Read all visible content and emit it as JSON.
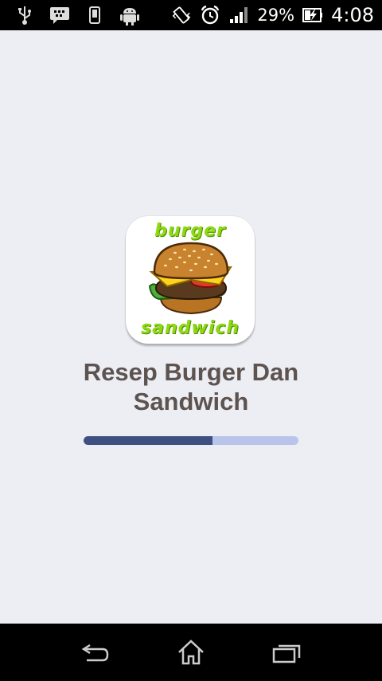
{
  "status_bar": {
    "battery_percent": "29%",
    "time": "4:08",
    "icons": [
      "usb-icon",
      "bbm-chat-icon",
      "phone-icon",
      "android-debug-icon",
      "vibrate-icon",
      "alarm-icon",
      "signal-icon",
      "battery-charging-icon"
    ]
  },
  "splash": {
    "logo_text_top": "burger",
    "logo_text_bottom": "sandwich",
    "title_line1": "Resep Burger Dan",
    "title_line2": "Sandwich",
    "progress": 0.6
  },
  "nav_bar": {
    "icons": [
      "back-icon",
      "home-icon",
      "recent-apps-icon"
    ]
  },
  "colors": {
    "background": "#eceef3",
    "title": "#5d5350",
    "progress_fill": "#3f5080",
    "progress_track": "#b8c4ea",
    "logo_green": "#8fd914"
  }
}
